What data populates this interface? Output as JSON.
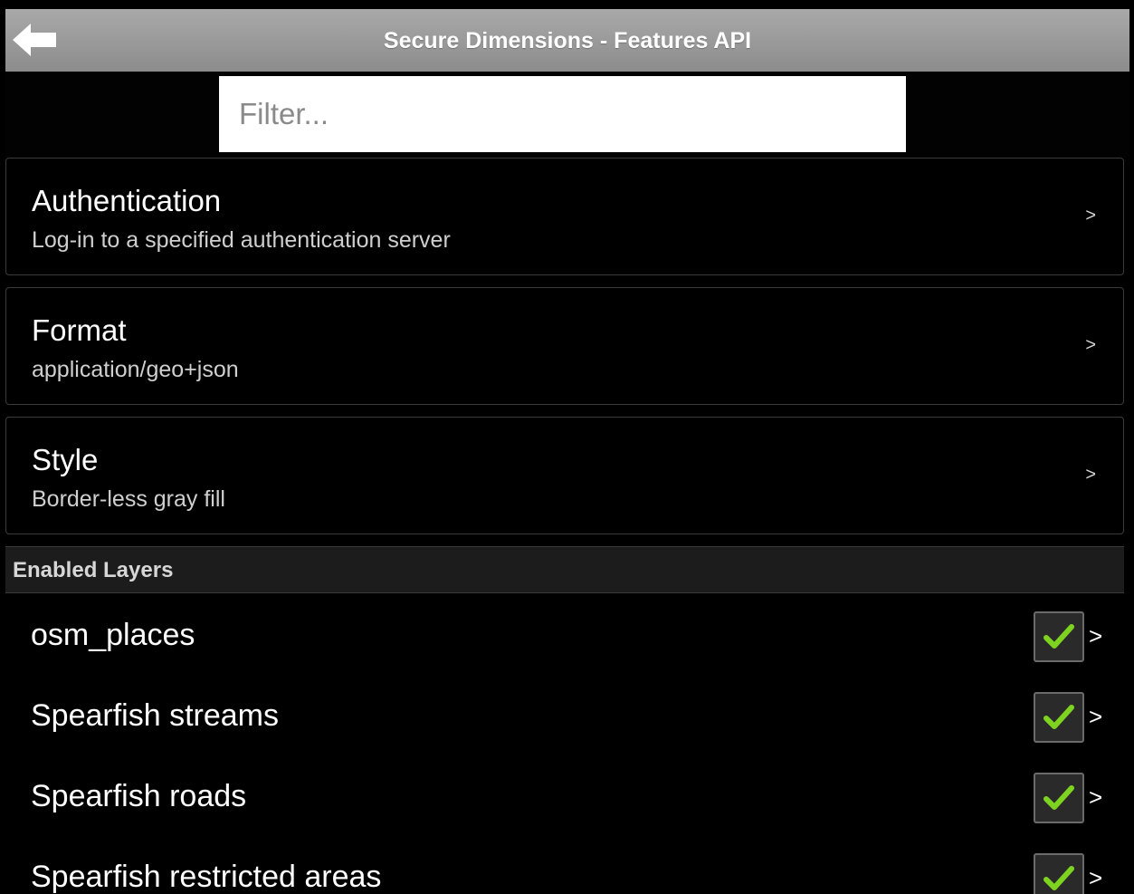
{
  "header": {
    "title": "Secure Dimensions - Features API",
    "back_icon": "back-arrow-icon"
  },
  "filter": {
    "placeholder": "Filter...",
    "value": ""
  },
  "settings": [
    {
      "title": "Authentication",
      "subtitle": "Log-in to a specified authentication server",
      "chevron": ">"
    },
    {
      "title": "Format",
      "subtitle": "application/geo+json",
      "chevron": ">"
    },
    {
      "title": "Style",
      "subtitle": "Border-less gray fill",
      "chevron": ">"
    }
  ],
  "layers_section": {
    "label": "Enabled Layers",
    "items": [
      {
        "name": "osm_places",
        "checked": true,
        "chevron": ">"
      },
      {
        "name": "Spearfish streams",
        "checked": true,
        "chevron": ">"
      },
      {
        "name": "Spearfish roads",
        "checked": true,
        "chevron": ">"
      },
      {
        "name": "Spearfish restricted areas",
        "checked": true,
        "chevron": ">"
      }
    ]
  },
  "colors": {
    "titlebar": "#9b9b9b",
    "background": "#000000",
    "check_mark": "#7ed321",
    "section_header": "#1c1c1c"
  }
}
